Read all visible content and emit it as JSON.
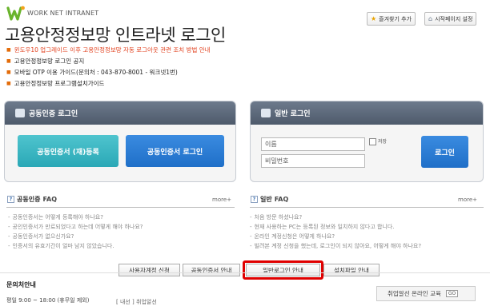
{
  "header": {
    "logo_text": "WORK NET INTRANET",
    "title": "고용안정정보망 인트라넷 로그인",
    "fav_label": "즐겨찾기 추가",
    "home_label": "시작페이지 설정"
  },
  "notices": [
    "윈도우10 업그레이드 이후 고용안정정보망 자동 로그아웃 관련 조치 방법 안내",
    "고용안정정보망 로그인 공지",
    "모바일 OTP 이용 가이드(문의처 : 043-870-8001 - 워크넷1번)",
    "고용안정정보망 프로그램설치가이드"
  ],
  "cert_panel": {
    "title": "공동인증 로그인",
    "register_label": "공동인증서 (재)등록",
    "login_label": "공동인증서 로그인"
  },
  "normal_panel": {
    "title": "일반 로그인",
    "name_placeholder": "이름",
    "pw_placeholder": "비밀번호",
    "save_label": "저장",
    "login_label": "로그인"
  },
  "faq_cert": {
    "category": "공동인증",
    "faq": "FAQ",
    "more": "more+",
    "items": [
      "공동인증서는 어떻게 등록해야 하나요?",
      "공인인증서가 만료되었다고 하는데 어떻게 해야 하나요?",
      "공동인증서가 없으신가요?",
      "인증서의 유효기간이 얼마 남지 않았습니다."
    ]
  },
  "faq_normal": {
    "category": "일반",
    "faq": "FAQ",
    "more": "more+",
    "items": [
      "처음 방문 하셨나요?",
      "현재 사용하는 PC는 등록된 정보와 일치하지 않다고 합니다.",
      "온라인 계정신청은 어떻게 하나요?",
      "빌려본 계정 신청을 했는데, 로그인이 되지 않아요, 어떻게 해야 하나요?"
    ]
  },
  "tabs": [
    "사용자계정 신청",
    "공동인증서 안내",
    "일반로그인 안내",
    "설치파일 안내"
  ],
  "contact": {
    "title": "문의처안내",
    "hours": "평일 9:00 ~ 18:00 (휴무일 제외)",
    "partial": "[ 내선 ] 취업알선"
  },
  "edu": {
    "label": "취업알선 온라인 교육",
    "go": "GO"
  },
  "colors": {
    "accent_red": "#e2421f",
    "button_blue": "#1f6fc8",
    "button_teal": "#2aa8b6",
    "panel_header": "#56627a",
    "highlight": "#e00000"
  }
}
